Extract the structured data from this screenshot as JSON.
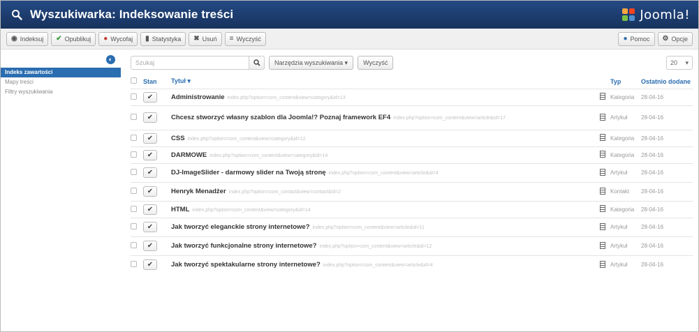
{
  "header": {
    "title": "Wyszukiwarka: Indeksowanie treści",
    "logo_text": "Joomla!",
    "accent": "#1b3a6b"
  },
  "toolbar": {
    "left": [
      {
        "icon": "eye-icon",
        "glyph": "◉",
        "label": "Indeksuj"
      },
      {
        "icon": "check-icon",
        "glyph": "✔",
        "label": "Opublikuj"
      },
      {
        "icon": "unpublish-icon",
        "glyph": "●",
        "label": "Wycofaj"
      },
      {
        "icon": "chart-icon",
        "glyph": "▮",
        "label": "Statystyka"
      },
      {
        "icon": "delete-icon",
        "glyph": "✖",
        "label": "Usuń"
      },
      {
        "icon": "list-icon",
        "glyph": "≡",
        "label": "Wyczyść"
      }
    ],
    "help_label": "Pomoc",
    "options_label": "Opcje"
  },
  "sidebar": {
    "items": [
      {
        "label": "Indeks zawartości",
        "active": true
      },
      {
        "label": "Mapy treści",
        "active": false
      },
      {
        "label": "Filtry wyszukiwania",
        "active": false
      }
    ]
  },
  "filters": {
    "search_placeholder": "Szukaj",
    "search_tools_label": "Narzędzia wyszukiwania ▾",
    "clear_label": "Wyczyść",
    "limit_value": "20"
  },
  "table": {
    "columns": {
      "state": "Stan",
      "title": "Tytuł ▾",
      "type": "Typ",
      "date": "Ostatnio dodane"
    },
    "rows": [
      {
        "title": "Administrowanie",
        "url": "index.php?option=com_content&view=category&id=13",
        "type": "Kategoria",
        "date": "28-04-16"
      },
      {
        "title": "Chcesz stworzyć własny szablon dla Joomla!? Poznaj framework EF4",
        "url": "index.php?option=com_content&view=article&id=17",
        "type": "Artykuł",
        "date": "28-04-16"
      },
      {
        "title": "CSS",
        "url": "index.php?option=com_content&view=category&id=12",
        "type": "Kategoria",
        "date": "28-04-16"
      },
      {
        "title": "DARMOWE",
        "url": "index.php?option=com_content&view=category&id=14",
        "type": "Kategoria",
        "date": "28-04-16"
      },
      {
        "title": "DJ-ImageSlider - darmowy slider na Twoją stronę",
        "url": "index.php?option=com_content&view=article&id=4",
        "type": "Artykuł",
        "date": "28-04-16"
      },
      {
        "title": "Henryk Menadżer",
        "url": "index.php?option=com_contact&view=contact&id=2",
        "type": "Kontakt",
        "date": "28-04-16"
      },
      {
        "title": "HTML",
        "url": "index.php?option=com_content&view=category&id=14",
        "type": "Kategoria",
        "date": "28-04-16"
      },
      {
        "title": "Jak tworzyć eleganckie strony internetowe?",
        "url": "index.php?option=com_content&view=article&id=11",
        "type": "Artykuł",
        "date": "28-04-16"
      },
      {
        "title": "Jak tworzyć funkcjonalne strony internetowe?",
        "url": "index.php?option=com_content&view=article&id=12",
        "type": "Artykuł",
        "date": "28-04-16"
      },
      {
        "title": "Jak tworzyć spektakularne strony internetowe?",
        "url": "index.php?option=com_content&view=article&id=4",
        "type": "Artykuł",
        "date": "28-04-16"
      }
    ]
  }
}
